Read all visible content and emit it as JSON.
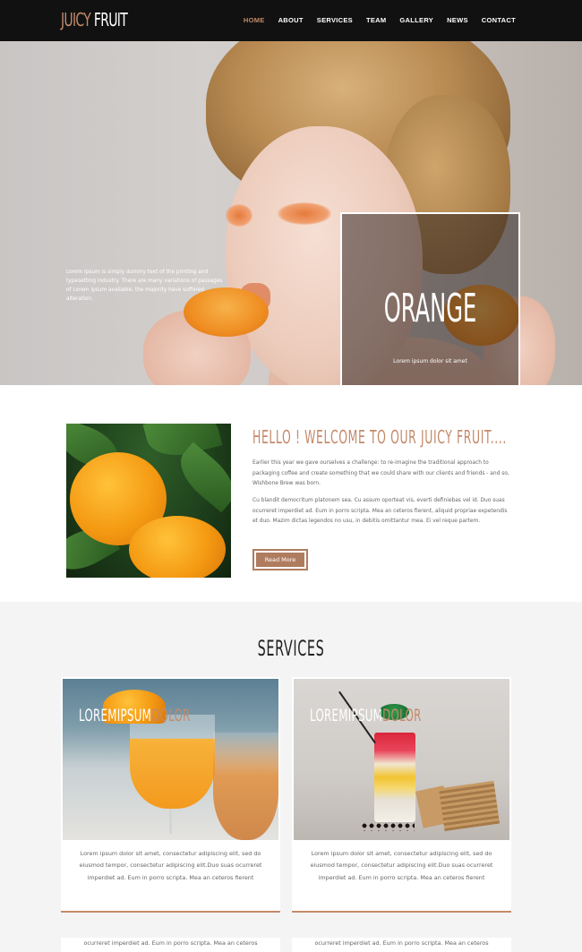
{
  "nav": {
    "logo_part1": "JUICY",
    "logo_part2": "FRUIT",
    "items": [
      {
        "label": "HOME",
        "active": true
      },
      {
        "label": "ABOUT",
        "active": false
      },
      {
        "label": "SERVICES",
        "active": false
      },
      {
        "label": "TEAM",
        "active": false
      },
      {
        "label": "GALLERY",
        "active": false
      },
      {
        "label": "NEWS",
        "active": false
      },
      {
        "label": "CONTACT",
        "active": false
      }
    ]
  },
  "hero": {
    "text": "Lorem Ipsum is simply dummy text of the printing and typesetting industry. There are many variations of passages of Lorem Ipsum available, the majority have suffered alteration.",
    "title": "ORANGE",
    "subtitle": "Lorem ipsum dolor sit amet",
    "slides": 3,
    "active_slide": 3
  },
  "about": {
    "heading": "HELLO ! WELCOME TO OUR JUICY FRUIT....",
    "paragraph1": "Earlier this year we gave ourselves a challenge: to re-imagine the traditional approach to packaging coffee and create something that we could share with our clients and friends - and so, Wishbone Brew was born.",
    "paragraph2": "Cu blandit democritum platonem sea. Cu assum oporteat vis, everti definiebas vel id. Duo suas ocurreret imperdiet ad. Eum in porro scripta. Mea an ceteros fierent, aliquid propriae expetendis et duo. Mazim dictas legendos no usu, in debitis omittantur mea. Ei vel reque partem.",
    "button": "Read More"
  },
  "services": {
    "heading": "SERVICES",
    "cards": [
      {
        "title_main": "LOREMIPSUM",
        "title_accent": "DOLOR",
        "text": "Lorem ipsum dolor sit amet, consectetur adipiscing elit, sed do eiusmod tempor, consectetur adipiscing elit.Duo suas ocurreret imperdiet ad. Eum in porro scripta. Mea an ceteros fierent"
      },
      {
        "title_main": "LOREMIPSUM",
        "title_accent": "DOLOR",
        "text": "Lorem ipsum dolor sit amet, consectetur adipiscing elit, sed do eiusmod tempor, consectetur adipiscing elit.Duo suas ocurreret imperdiet ad. Eum in porro scripta. Mea an ceteros fierent"
      }
    ],
    "next_row_text": "ocurreret imperdiet ad. Eum in porro scripta. Mea an ceteros"
  },
  "colors": {
    "accent": "#c48a6a",
    "nav_bg": "#111111"
  }
}
